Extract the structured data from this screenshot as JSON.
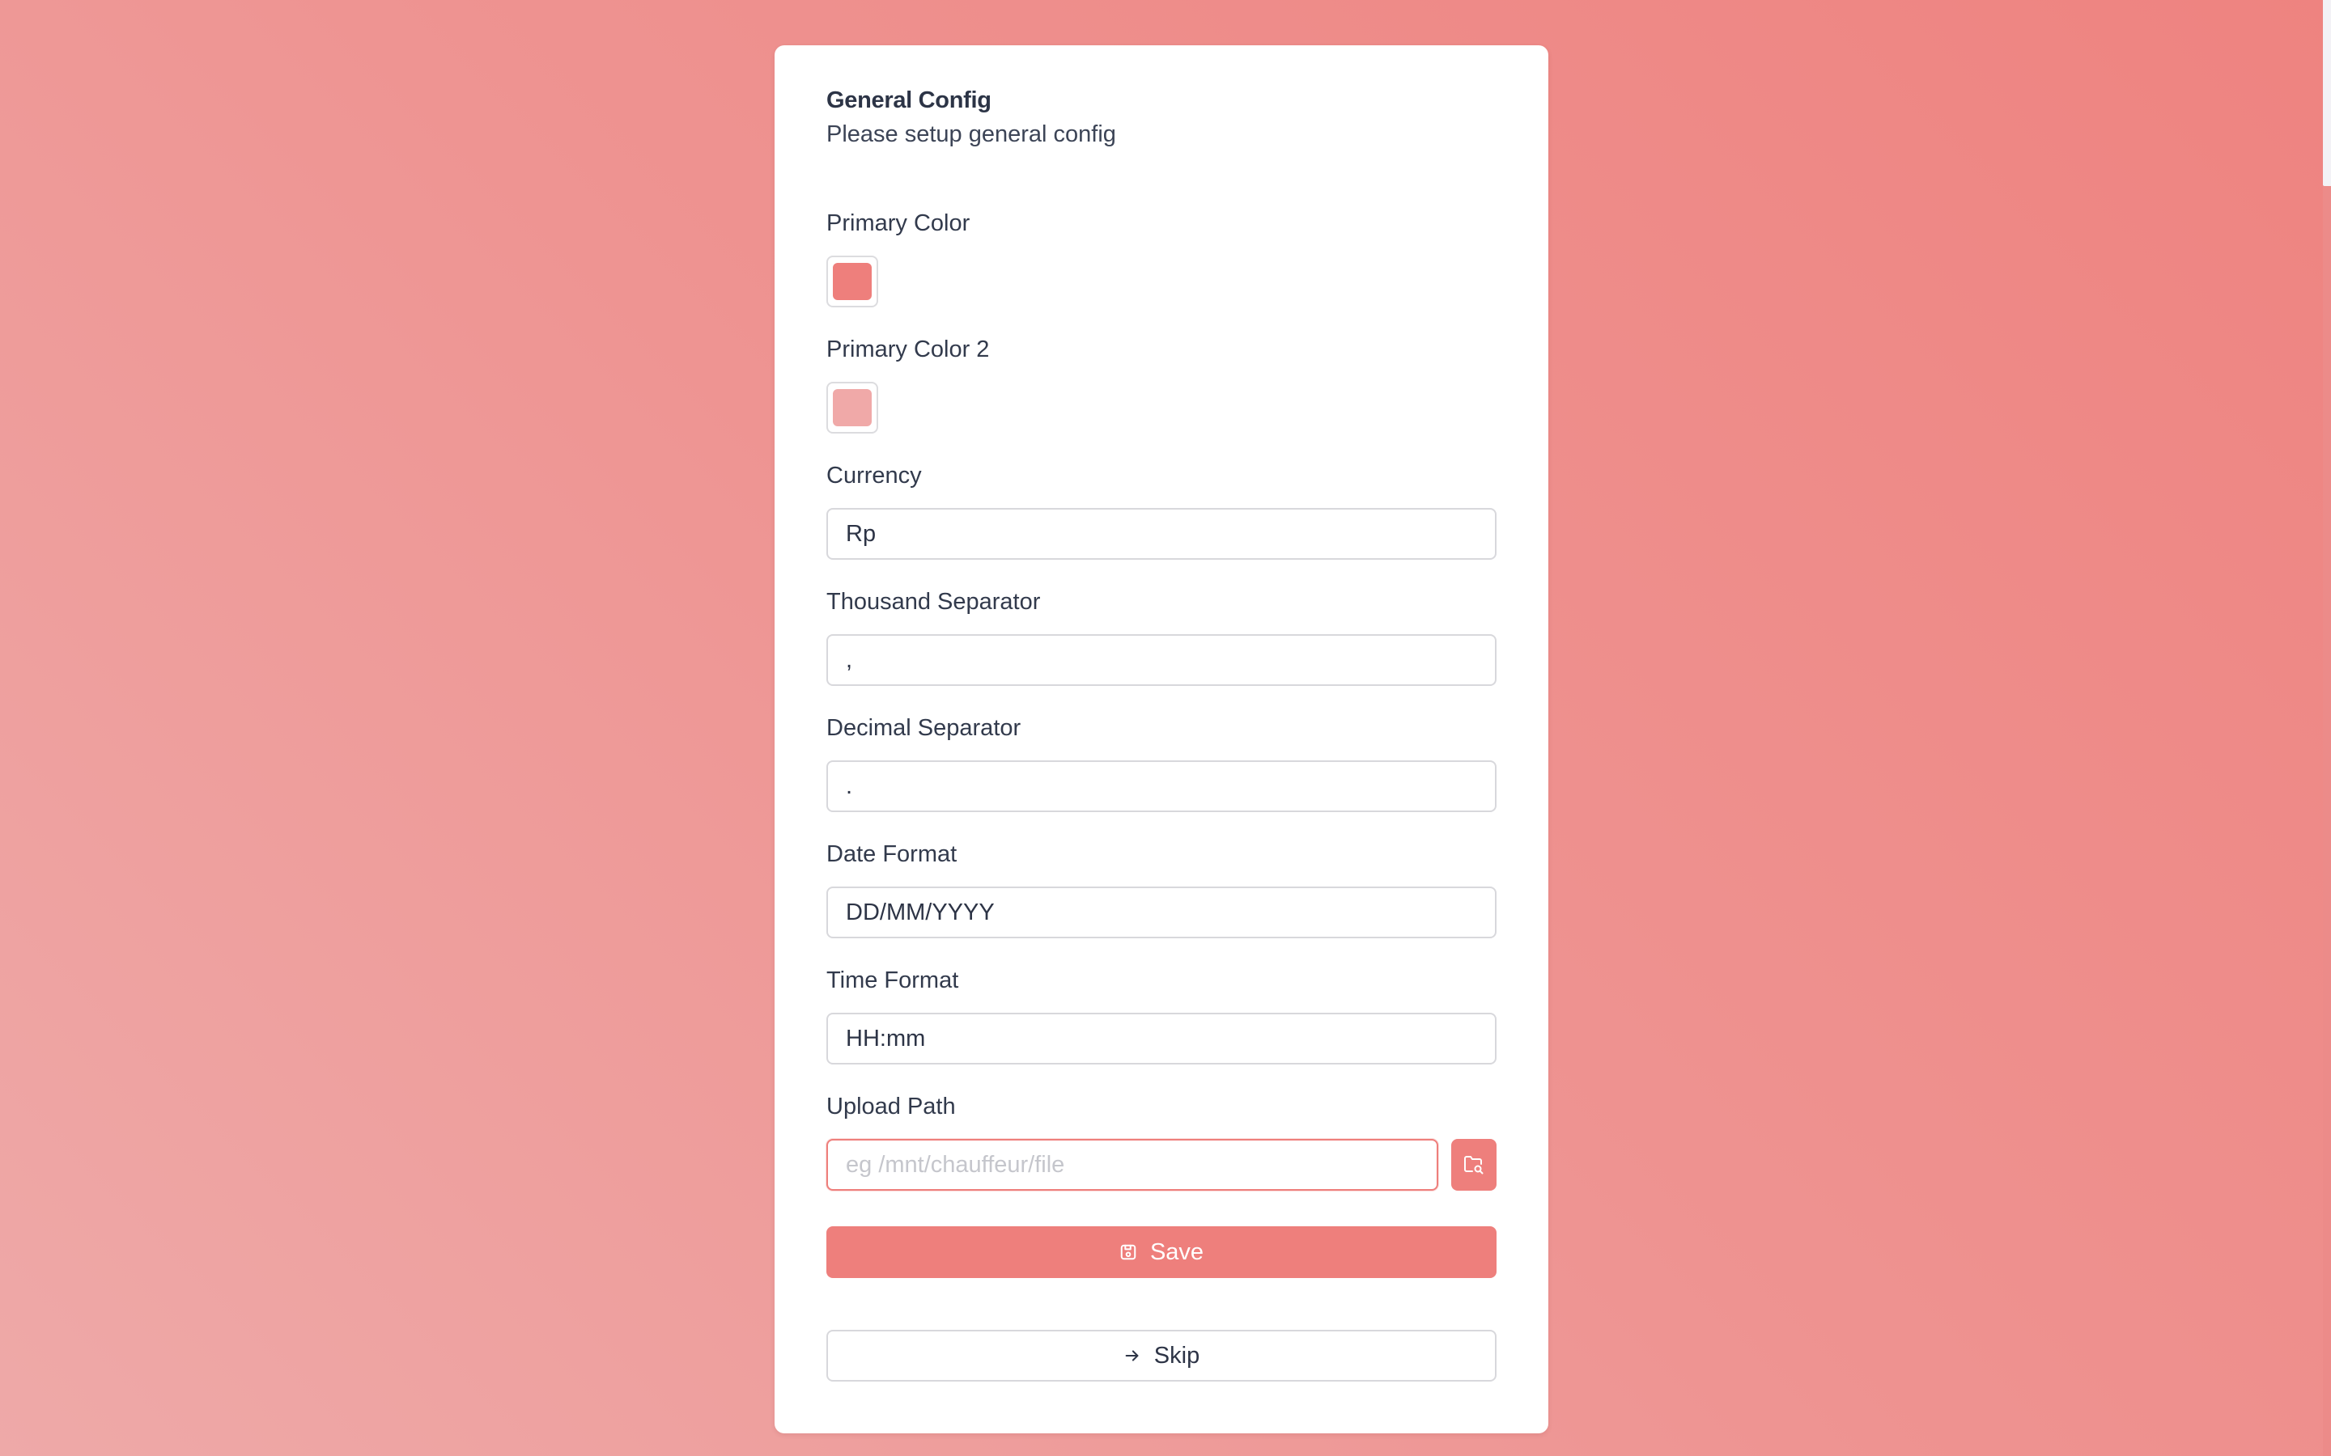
{
  "header": {
    "title": "General Config",
    "subtitle": "Please setup general config"
  },
  "fields": {
    "primary_color": {
      "label": "Primary Color",
      "value": "#ee7f7c"
    },
    "primary_color_2": {
      "label": "Primary Color 2",
      "value": "#f0a9a8"
    },
    "currency": {
      "label": "Currency",
      "value": "Rp"
    },
    "thousand_separator": {
      "label": "Thousand Separator",
      "value": ","
    },
    "decimal_separator": {
      "label": "Decimal Separator",
      "value": "."
    },
    "date_format": {
      "label": "Date Format",
      "value": "DD/MM/YYYY"
    },
    "time_format": {
      "label": "Time Format",
      "value": "HH:mm"
    },
    "upload_path": {
      "label": "Upload Path",
      "value": "",
      "placeholder": "eg /mnt/chauffeur/file",
      "browse_icon": "folder-search-icon"
    }
  },
  "actions": {
    "save_label": "Save",
    "save_icon": "save-icon",
    "skip_label": "Skip",
    "skip_icon": "arrow-right-icon"
  },
  "colors": {
    "accent": "#ee7f7c",
    "background_start": "#ee8380",
    "background_end": "#eea9a8",
    "card": "#ffffff",
    "text": "#2d3446"
  }
}
